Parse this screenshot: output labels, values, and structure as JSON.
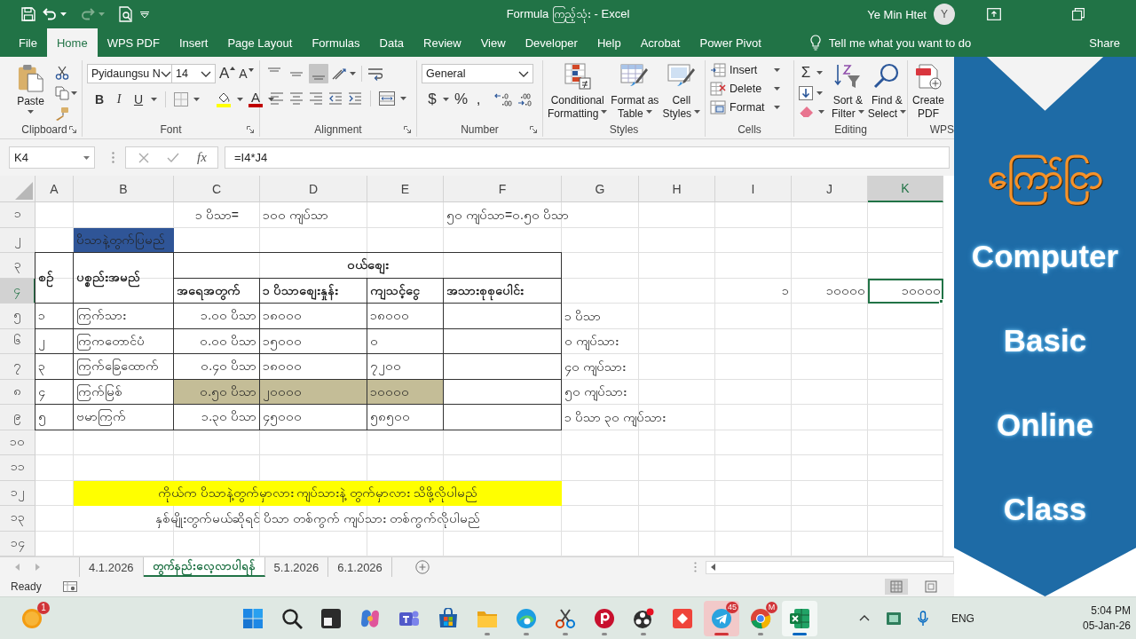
{
  "title_bar": {
    "quick_access": [
      {
        "kind": "save",
        "disabled": false
      },
      {
        "kind": "undo",
        "disabled": false
      },
      {
        "kind": "redo",
        "disabled": true
      },
      {
        "kind": "print-preview",
        "disabled": false
      },
      {
        "kind": "customize",
        "disabled": false
      }
    ],
    "title": "Formula ကြည့်သုံး - Excel",
    "user": "Ye Min Htet",
    "avatar": "Y"
  },
  "ribbon_tabs": [
    {
      "label": "File",
      "selected": false
    },
    {
      "label": "Home",
      "selected": true
    },
    {
      "label": "WPS PDF",
      "selected": false
    },
    {
      "label": "Insert",
      "selected": false
    },
    {
      "label": "Page Layout",
      "selected": false
    },
    {
      "label": "Formulas",
      "selected": false
    },
    {
      "label": "Data",
      "selected": false
    },
    {
      "label": "Review",
      "selected": false
    },
    {
      "label": "View",
      "selected": false
    },
    {
      "label": "Developer",
      "selected": false
    },
    {
      "label": "Help",
      "selected": false
    },
    {
      "label": "Acrobat",
      "selected": false
    },
    {
      "label": "Power Pivot",
      "selected": false
    }
  ],
  "tell_me": "Tell me what you want to do",
  "share": "Share",
  "ribbon": {
    "clipboard": {
      "paste": "Paste",
      "label": "Clipboard"
    },
    "font": {
      "name": "Pyidaungsu N",
      "size": "14",
      "grow": "A",
      "shrink": "A",
      "styles": [
        {
          "kind": "bold",
          "label": "B"
        },
        {
          "kind": "italic",
          "label": "I"
        },
        {
          "kind": "underline",
          "label": "U"
        }
      ],
      "font_color": "A",
      "label": "Font"
    },
    "alignment": {
      "vertical": [
        {
          "kind": "top",
          "selected": false
        },
        {
          "kind": "middle",
          "selected": false
        },
        {
          "kind": "bottom",
          "selected": true
        }
      ],
      "label": "Alignment"
    },
    "number": {
      "format": "General",
      "symbols": [
        {
          "kind": "currency",
          "label": "$"
        },
        {
          "kind": "percent",
          "label": "%"
        },
        {
          "kind": "comma",
          "label": ","
        }
      ],
      "label": "Number"
    },
    "styles": {
      "buttons": [
        {
          "kind": "conditional",
          "lines": [
            "Conditional",
            "Formatting"
          ]
        },
        {
          "kind": "table",
          "lines": [
            "Format as",
            "Table"
          ]
        },
        {
          "kind": "cell-styles",
          "lines": [
            "Cell",
            "Styles"
          ]
        }
      ],
      "label": "Styles"
    },
    "cells": {
      "buttons": [
        {
          "kind": "insert",
          "label": "Insert"
        },
        {
          "kind": "delete",
          "label": "Delete"
        },
        {
          "kind": "format",
          "label": "Format"
        }
      ],
      "label": "Cells"
    },
    "editing": {
      "sum": "Σ",
      "buttons": [
        {
          "kind": "sort",
          "lines": [
            "Sort &",
            "Filter"
          ]
        },
        {
          "kind": "find",
          "lines": [
            "Find &",
            "Select"
          ]
        }
      ],
      "label": "Editing"
    },
    "wps": {
      "lines": [
        "Create",
        "PDF"
      ],
      "label": "WPS"
    }
  },
  "formula_bar": {
    "name_box": "K4",
    "function_label": "fx",
    "formula": "=I4*J4"
  },
  "sheet": {
    "columns": [
      {
        "label": "A",
        "selected": false
      },
      {
        "label": "B",
        "selected": false
      },
      {
        "label": "C",
        "selected": false
      },
      {
        "label": "D",
        "selected": false
      },
      {
        "label": "E",
        "selected": false
      },
      {
        "label": "F",
        "selected": false
      },
      {
        "label": "G",
        "selected": false
      },
      {
        "label": "H",
        "selected": false
      },
      {
        "label": "I",
        "selected": false
      },
      {
        "label": "J",
        "selected": false
      },
      {
        "label": "K",
        "selected": true
      }
    ],
    "rows": [
      {
        "label": "၁",
        "selected": false,
        "cells": [
          {
            "kind": "blank"
          },
          {
            "kind": "blank"
          },
          {
            "kind": "center",
            "text": "၁ ပိသာ="
          },
          {
            "kind": "text",
            "text": "၁၀၀ ကျပ်သာ"
          },
          {
            "kind": "blank"
          },
          {
            "kind": "text",
            "text": "၅၀ ကျပ်သာ=၀.၅၀ ပိသာ"
          },
          {
            "kind": "blank"
          },
          {
            "kind": "blank"
          },
          {
            "kind": "blank"
          },
          {
            "kind": "blank"
          },
          {
            "kind": "blank"
          }
        ]
      },
      {
        "label": "၂",
        "selected": false,
        "cells": [
          {
            "kind": "blank"
          },
          {
            "kind": "text",
            "text": "ပိသာနဲ့တွက်ပြမည်",
            "color": "#2f5597"
          },
          {
            "kind": "blank"
          },
          {
            "kind": "blank"
          },
          {
            "kind": "blank"
          },
          {
            "kind": "blank"
          },
          {
            "kind": "blank"
          },
          {
            "kind": "blank"
          },
          {
            "kind": "blank"
          },
          {
            "kind": "blank"
          },
          {
            "kind": "blank"
          }
        ]
      },
      {
        "label": "၃",
        "selected": false,
        "cells": [
          {
            "kind": "box-heading",
            "text": "စဉ်"
          },
          {
            "kind": "box-heading",
            "text": "ပစ္စည်းအမည်"
          },
          {
            "kind": "box-title",
            "text": "ဝယ်စျေး"
          },
          {
            "kind": "merged-left"
          },
          {
            "kind": "merged-left"
          },
          {
            "kind": "merged-left"
          },
          {
            "kind": "blank"
          },
          {
            "kind": "blank"
          },
          {
            "kind": "blank"
          },
          {
            "kind": "blank"
          },
          {
            "kind": "blank"
          }
        ]
      },
      {
        "label": "၄",
        "selected": true,
        "cells": [
          {
            "kind": "merged-up"
          },
          {
            "kind": "merged-up"
          },
          {
            "kind": "box-heading",
            "text": "အရေအတွက်"
          },
          {
            "kind": "box-heading",
            "text": "၁ ပိသာစျေးနှုန်း"
          },
          {
            "kind": "box-heading",
            "text": "ကျသင့်ငွေ"
          },
          {
            "kind": "box-heading",
            "text": "အသားစုစုပေါင်း"
          },
          {
            "kind": "blank"
          },
          {
            "kind": "blank"
          },
          {
            "kind": "number",
            "text": "၁"
          },
          {
            "kind": "number",
            "text": "၁၀၀၀၀"
          },
          {
            "kind": "number",
            "text": "၁၀၀၀၀"
          }
        ]
      },
      {
        "label": "၅",
        "selected": false,
        "cells": [
          {
            "kind": "box-text",
            "text": "၁"
          },
          {
            "kind": "box-text",
            "text": "ကြက်သား"
          },
          {
            "kind": "box-number",
            "text": "၁.၀၀ ပိသာ"
          },
          {
            "kind": "box-text",
            "text": "၁၈၀၀၀"
          },
          {
            "kind": "box-text",
            "text": "၁၈၀၀၀"
          },
          {
            "kind": "box-blank"
          },
          {
            "kind": "text",
            "text": "၁ ပိသာ"
          },
          {
            "kind": "blank"
          },
          {
            "kind": "blank"
          },
          {
            "kind": "blank"
          },
          {
            "kind": "blank"
          }
        ]
      },
      {
        "label": "၆",
        "selected": false,
        "cells": [
          {
            "kind": "box-text",
            "text": "၂"
          },
          {
            "kind": "box-text",
            "text": "ကြကတောင်ပံ"
          },
          {
            "kind": "box-number",
            "text": "၀.၀၀ ပိသာ"
          },
          {
            "kind": "box-text",
            "text": "၁၅၀၀၀"
          },
          {
            "kind": "box-text",
            "text": "၀"
          },
          {
            "kind": "box-blank"
          },
          {
            "kind": "text",
            "text": "၀ ကျပ်သား"
          },
          {
            "kind": "blank"
          },
          {
            "kind": "blank"
          },
          {
            "kind": "blank"
          },
          {
            "kind": "blank"
          }
        ]
      },
      {
        "label": "၇",
        "selected": false,
        "cells": [
          {
            "kind": "box-text",
            "text": "၃"
          },
          {
            "kind": "box-text",
            "text": "ကြက်ခြေထောက်"
          },
          {
            "kind": "box-number",
            "text": "၀.၄၀ ပိသာ"
          },
          {
            "kind": "box-text",
            "text": "၁၈၀၀၀"
          },
          {
            "kind": "box-text",
            "text": "၇၂၀၀"
          },
          {
            "kind": "box-blank"
          },
          {
            "kind": "text",
            "text": "၄၀ ကျပ်သား"
          },
          {
            "kind": "blank"
          },
          {
            "kind": "blank"
          },
          {
            "kind": "blank"
          },
          {
            "kind": "blank"
          }
        ]
      },
      {
        "label": "၈",
        "selected": false,
        "cells": [
          {
            "kind": "box-text",
            "text": "၄"
          },
          {
            "kind": "box-text",
            "text": "ကြက်မြစ်"
          },
          {
            "kind": "box-number",
            "text": "၀.၅၀ ပိသာ",
            "color": "#c4bd97"
          },
          {
            "kind": "box-text",
            "text": "၂၀၀၀၀",
            "color": "#c4bd97"
          },
          {
            "kind": "box-text",
            "text": "၁၀၀၀၀",
            "color": "#c4bd97"
          },
          {
            "kind": "box-blank"
          },
          {
            "kind": "text",
            "text": "၅၀ ကျပ်သား"
          },
          {
            "kind": "blank"
          },
          {
            "kind": "blank"
          },
          {
            "kind": "blank"
          },
          {
            "kind": "blank"
          }
        ]
      },
      {
        "label": "၉",
        "selected": false,
        "cells": [
          {
            "kind": "box-text",
            "text": "၅"
          },
          {
            "kind": "box-text",
            "text": "ဗမာကြက်"
          },
          {
            "kind": "box-number",
            "text": "၁.၃၀ ပိသာ"
          },
          {
            "kind": "box-text",
            "text": "၄၅၀၀၀"
          },
          {
            "kind": "box-text",
            "text": "၅၈၅၀၀"
          },
          {
            "kind": "box-blank"
          },
          {
            "kind": "text",
            "text": "၁ ပိသာ ၃၀ ကျပ်သား"
          },
          {
            "kind": "blank"
          },
          {
            "kind": "blank"
          },
          {
            "kind": "blank"
          },
          {
            "kind": "blank"
          }
        ]
      },
      {
        "label": "၁၀",
        "selected": false,
        "cells": [
          {
            "kind": "blank"
          },
          {
            "kind": "blank"
          },
          {
            "kind": "blank"
          },
          {
            "kind": "blank"
          },
          {
            "kind": "blank"
          },
          {
            "kind": "blank"
          },
          {
            "kind": "blank"
          },
          {
            "kind": "blank"
          },
          {
            "kind": "blank"
          },
          {
            "kind": "blank"
          },
          {
            "kind": "blank"
          }
        ]
      },
      {
        "label": "၁၁",
        "selected": false,
        "cells": [
          {
            "kind": "blank"
          },
          {
            "kind": "blank"
          },
          {
            "kind": "blank"
          },
          {
            "kind": "blank"
          },
          {
            "kind": "blank"
          },
          {
            "kind": "blank"
          },
          {
            "kind": "blank"
          },
          {
            "kind": "blank"
          },
          {
            "kind": "blank"
          },
          {
            "kind": "blank"
          },
          {
            "kind": "blank"
          }
        ]
      },
      {
        "label": "၁၂",
        "selected": false,
        "cells": [
          {
            "kind": "blank"
          },
          {
            "kind": "banner",
            "text": "ကိုယ်က ပိသာနဲ့တွက်မှာလား ကျပ်သားနဲ့ တွက်မှာလား သိဖို့လိုပါမည်",
            "color": "#ffff00"
          },
          {
            "kind": "merged-left"
          },
          {
            "kind": "merged-left"
          },
          {
            "kind": "merged-left"
          },
          {
            "kind": "merged-left"
          },
          {
            "kind": "blank"
          },
          {
            "kind": "blank"
          },
          {
            "kind": "blank"
          },
          {
            "kind": "blank"
          },
          {
            "kind": "blank"
          }
        ]
      },
      {
        "label": "၁၃",
        "selected": false,
        "cells": [
          {
            "kind": "blank"
          },
          {
            "kind": "banner",
            "text": "နှစ်မျိုးတွက်မယ်ဆိုရင် ပိသာ တစ်ကွက် ကျပ်သား တစ်ကွက်လိုပါမည်"
          },
          {
            "kind": "merged-left"
          },
          {
            "kind": "merged-left"
          },
          {
            "kind": "merged-left"
          },
          {
            "kind": "merged-left"
          },
          {
            "kind": "blank"
          },
          {
            "kind": "blank"
          },
          {
            "kind": "blank"
          },
          {
            "kind": "blank"
          },
          {
            "kind": "blank"
          }
        ]
      },
      {
        "label": "၁၄",
        "selected": false,
        "cells": [
          {
            "kind": "blank"
          },
          {
            "kind": "blank"
          },
          {
            "kind": "blank"
          },
          {
            "kind": "blank"
          },
          {
            "kind": "blank"
          },
          {
            "kind": "blank"
          },
          {
            "kind": "blank"
          },
          {
            "kind": "blank"
          },
          {
            "kind": "blank"
          },
          {
            "kind": "blank"
          },
          {
            "kind": "blank"
          }
        ]
      }
    ]
  },
  "sheet_tabs": [
    {
      "label": "4.1.2026",
      "selected": false
    },
    {
      "label": "တွက်နည်းလေ့လာပါရန်",
      "selected": true
    },
    {
      "label": "5.1.2026",
      "selected": false
    },
    {
      "label": "6.1.2026",
      "selected": false
    }
  ],
  "status_bar": {
    "status": "Ready",
    "views": [
      {
        "kind": "normal",
        "selected": true
      },
      {
        "kind": "page-layout",
        "selected": false
      }
    ]
  },
  "taskbar": {
    "weather_badge": "1",
    "apps": [
      {
        "kind": "start",
        "open": false,
        "focused": false,
        "attention": false
      },
      {
        "kind": "search",
        "open": false,
        "focused": false,
        "attention": false
      },
      {
        "kind": "task-view",
        "open": false,
        "focused": false,
        "attention": false
      },
      {
        "kind": "copilot",
        "open": false,
        "focused": false,
        "attention": false
      },
      {
        "kind": "teams",
        "open": false,
        "focused": false,
        "attention": false
      },
      {
        "kind": "store",
        "open": false,
        "focused": false,
        "attention": false
      },
      {
        "kind": "explorer",
        "open": true,
        "focused": false,
        "attention": false
      },
      {
        "kind": "edge",
        "open": true,
        "focused": false,
        "attention": false
      },
      {
        "kind": "snipping",
        "open": true,
        "focused": false,
        "attention": false
      },
      {
        "kind": "p-app",
        "open": true,
        "focused": false,
        "attention": false
      },
      {
        "kind": "obs",
        "open": true,
        "focused": false,
        "attention": false
      },
      {
        "kind": "anydesk",
        "open": false,
        "focused": false,
        "attention": false
      },
      {
        "kind": "telegram",
        "open": true,
        "focused": false,
        "attention": true,
        "badge": "45"
      },
      {
        "kind": "chrome",
        "open": true,
        "focused": false,
        "attention": false,
        "badge": "M"
      },
      {
        "kind": "excel",
        "open": true,
        "focused": true,
        "attention": false
      }
    ],
    "language": "ENG",
    "time": "5:04 PM",
    "date": "05-Jan-26"
  },
  "promo": {
    "logo": "ကြော်ငြာ",
    "lines": [
      "Computer",
      "Basic",
      "Online",
      "Class"
    ]
  }
}
